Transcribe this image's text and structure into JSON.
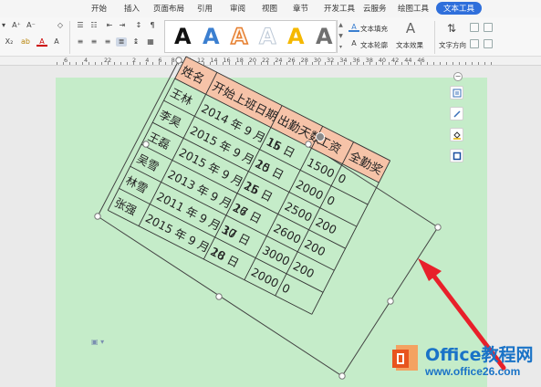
{
  "menu": {
    "tabs": [
      "开始",
      "插入",
      "页面布局",
      "引用",
      "审阅",
      "视图",
      "章节",
      "开发工具",
      "云服务",
      "绘图工具",
      "文本工具"
    ],
    "active_tab": "文本工具"
  },
  "ribbon": {
    "gallery_letters": [
      "A",
      "A",
      "A",
      "A",
      "A",
      "A"
    ],
    "gallery_colors": [
      "#111111",
      "#3b7fd0",
      "#e67e2e",
      "#bcc8d6",
      "#f5b800",
      "#707070"
    ],
    "text_fill_label": "文本填充",
    "text_outline_label": "文本轮廓",
    "text_effect_label": "文本效果",
    "text_direction_label": "文字方向"
  },
  "ruler": {
    "numbers_left": [
      "6",
      "4",
      "2",
      "2"
    ],
    "numbers_right": [
      "2",
      "4",
      "6",
      "8",
      "10",
      "12",
      "14",
      "16",
      "18",
      "20",
      "22",
      "24",
      "26",
      "28",
      "30",
      "32",
      "34",
      "36",
      "38",
      "40",
      "42",
      "44",
      "46"
    ]
  },
  "table": {
    "headers": [
      "姓名",
      "开始上班日期",
      "出勤天数",
      "工资",
      "全勤奖"
    ],
    "rows": [
      [
        "王林",
        "2014 年 9 月 16 日",
        "15",
        "1500",
        "0"
      ],
      [
        "李昊",
        "2015 年 9 月 15 日",
        "20",
        "2000",
        "0"
      ],
      [
        "王磊",
        "2015 年 9 月 16 日",
        "25",
        "2500",
        "200"
      ],
      [
        "吴雪",
        "2013 年 9 月 17 日",
        "26",
        "2600",
        "200"
      ],
      [
        "林雪",
        "2011 年 9 月 17 日",
        "30",
        "3000",
        "200"
      ],
      [
        "张强",
        "2015 年 9 月 18 日",
        "20",
        "2000",
        "0"
      ]
    ],
    "header_color": "#f6c3a8",
    "page_color": "#c5ecc9"
  },
  "side_tools": [
    "layout-options-icon",
    "pen-icon",
    "fill-bucket-icon",
    "border-icon"
  ],
  "watermark": {
    "title": "Office教程网",
    "url": "www.office26.com",
    "brand_color": "#e8541e",
    "text_color": "#1a73c7"
  },
  "colors": {
    "accent": "#2f6fdb",
    "arrow": "#e8202a"
  }
}
